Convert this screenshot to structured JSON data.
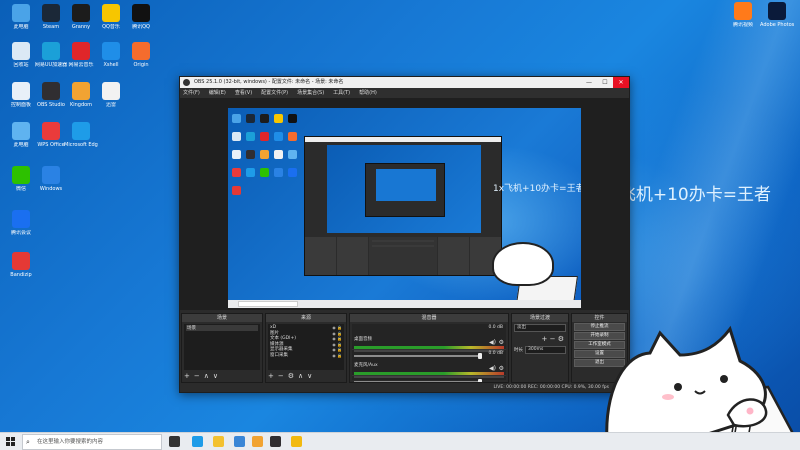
{
  "desktop": {
    "left_icons": [
      {
        "label": "此电脑",
        "color": "#4aa3e8"
      },
      {
        "label": "Steam",
        "color": "#1b2838"
      },
      {
        "label": "Granny",
        "color": "#1c1c1c"
      },
      {
        "label": "QQ音乐",
        "color": "#f7c600"
      },
      {
        "label": "腾讯QQ",
        "color": "#111111"
      },
      {
        "label": "回收站",
        "color": "#dbe9f5"
      },
      {
        "label": "网易UU加速器",
        "color": "#1ba0d8"
      },
      {
        "label": "网易云音乐",
        "color": "#e0262a"
      },
      {
        "label": "Xshell",
        "color": "#1f8ee8"
      },
      {
        "label": "Origin",
        "color": "#f56c2d"
      },
      {
        "label": "控制面板",
        "color": "#e8f0f8"
      },
      {
        "label": "OBS Studio",
        "color": "#302e31"
      },
      {
        "label": "Kingdom",
        "color": "#f1a332"
      },
      {
        "label": "迅雷",
        "color": "#f2f2f2"
      },
      {
        "label": "此电脑",
        "color": "#5fb3f0"
      },
      {
        "label": "WPS Office",
        "color": "#ea3b3b"
      },
      {
        "label": "Microsoft Edge",
        "color": "#1e9ce8"
      },
      {
        "label": "微信",
        "color": "#2dc100"
      },
      {
        "label": "Windows",
        "color": "#2a82e4"
      },
      {
        "label": "腾讯会议",
        "color": "#1a6ff0"
      },
      {
        "label": "Bandizip",
        "color": "#e53935"
      }
    ],
    "right_icons": [
      {
        "label": "腾讯视频",
        "color": "#ff7a1a"
      },
      {
        "label": "Adobe Photosh...",
        "color": "#0a1a3a"
      }
    ],
    "overlay_text": "1x飞机+10办卡=王者",
    "accent_color": "#1778d4"
  },
  "obs": {
    "title": "OBS 25.1.0 (32-bit, windows) - 配置文件: 未命名 - 场景: 未命名",
    "controls": [
      "—",
      "☐",
      "✕"
    ],
    "menu": [
      "文件(F)",
      "编辑(E)",
      "查看(V)",
      "配置文件(P)",
      "场景集合(S)",
      "工具(T)",
      "帮助(H)"
    ],
    "preview_text": "1x飞机+10办卡=王者",
    "docks": {
      "scenes": {
        "header": "场景",
        "items": [
          "场景"
        ]
      },
      "sources": {
        "header": "来源",
        "items": [
          "xD",
          "图片",
          "文本 (GDI+)",
          "媒体源",
          "显示器采集",
          "窗口采集"
        ]
      },
      "mixer": {
        "header": "混音器",
        "channels": [
          {
            "name": "桌面音频",
            "db": "0.0 dB"
          },
          {
            "name": "麦克风/Aux",
            "db": "0.0 dB"
          }
        ]
      },
      "transitions": {
        "header": "场景过渡",
        "type": "淡出",
        "duration_label": "时长",
        "duration": "300ms"
      },
      "controls": {
        "header": "控件",
        "buttons": [
          "停止推流",
          "开始录制",
          "工作室模式",
          "设置",
          "退出"
        ]
      }
    },
    "status": "LIVE: 00:00:00   REC: 00:00:00   CPU: 0.9%, 30.00 fps"
  },
  "taskbar": {
    "search_placeholder": "在这里输入你要搜索的内容",
    "apps": [
      {
        "name": "task-view",
        "color": "#333333"
      },
      {
        "name": "edge",
        "color": "#1e9ce8"
      },
      {
        "name": "file-explorer",
        "color": "#f3c130"
      },
      {
        "name": "store",
        "color": "#3a86d6"
      },
      {
        "name": "kingdom",
        "color": "#f1a332"
      },
      {
        "name": "obs",
        "color": "#302e31"
      },
      {
        "name": "chrome",
        "color": "#f2b90f"
      }
    ]
  }
}
